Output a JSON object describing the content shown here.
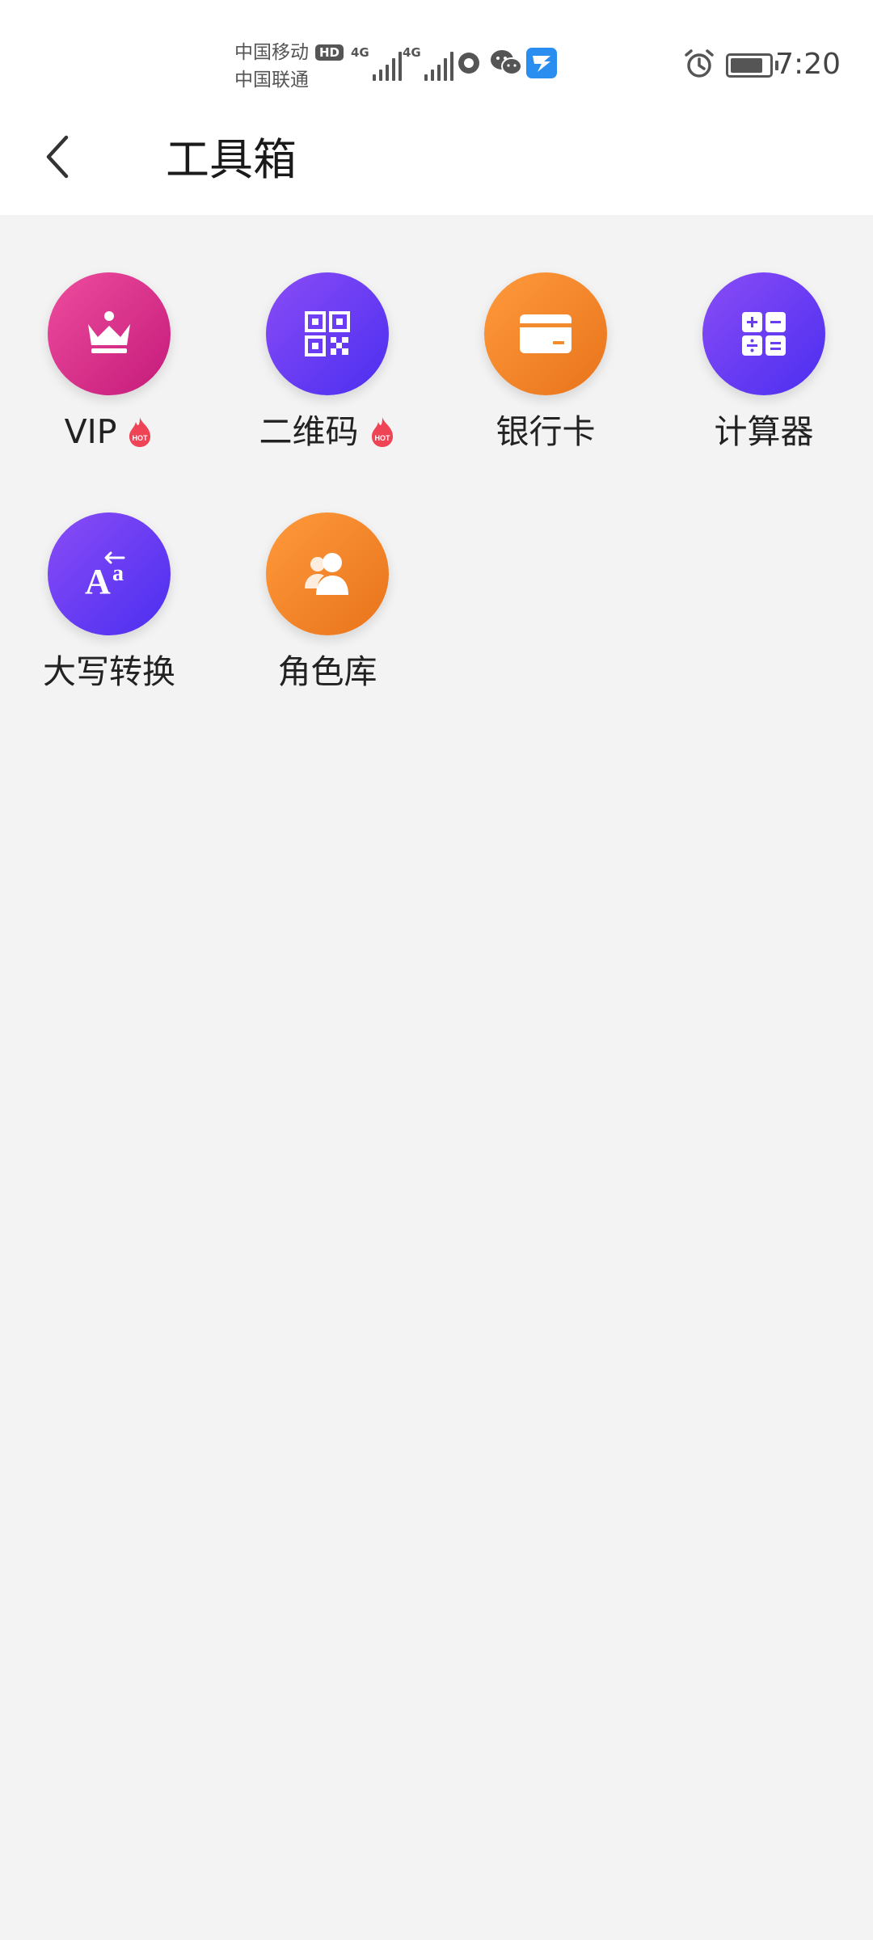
{
  "status_bar": {
    "carrier_1": "中国移动",
    "carrier_2": "中国联通",
    "hd_badge": "HD",
    "network_1": "4G",
    "network_2": "4G",
    "time": "7:20",
    "battery_level": 0.85
  },
  "header": {
    "title": "工具箱"
  },
  "tools": [
    {
      "label": "VIP",
      "icon": "crown-icon",
      "hot": true
    },
    {
      "label": "二维码",
      "icon": "qr-code-icon",
      "hot": true
    },
    {
      "label": "银行卡",
      "icon": "bank-card-icon",
      "hot": false
    },
    {
      "label": "计算器",
      "icon": "calculator-icon",
      "hot": false
    },
    {
      "label": "大写转换",
      "icon": "case-convert-icon",
      "hot": false
    },
    {
      "label": "角色库",
      "icon": "users-icon",
      "hot": false
    }
  ],
  "colors": {
    "pink": "#e0378f",
    "purple": "#6a3df3",
    "orange": "#f5862b",
    "hot_badge": "#ee4455"
  }
}
